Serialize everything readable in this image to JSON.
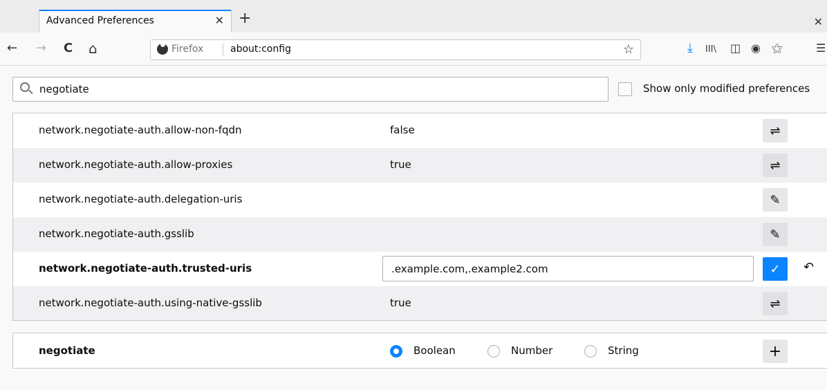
{
  "tab": {
    "title": "Advanced Preferences",
    "close": "✕",
    "new_tab": "+"
  },
  "window": {
    "close": "✕"
  },
  "nav": {
    "back": "←",
    "forward": "→",
    "reload": "C",
    "home": "⌂",
    "identity": "Firefox",
    "url": "about:config",
    "bookmark_star": "☆",
    "download": "⤓",
    "library": "III\\",
    "sidebar": "◫",
    "account": "◉",
    "customize": "⚝",
    "menu": "☰"
  },
  "search": {
    "value": "negotiate",
    "show_modified_label": "Show only modified preferences",
    "show_modified_checked": false
  },
  "prefs": [
    {
      "name": "network.negotiate-auth.allow-non-fqdn",
      "value": "false",
      "action": "⇌",
      "action_type": "toggle",
      "modified": false
    },
    {
      "name": "network.negotiate-auth.allow-proxies",
      "value": "true",
      "action": "⇌",
      "action_type": "toggle",
      "modified": false
    },
    {
      "name": "network.negotiate-auth.delegation-uris",
      "value": "",
      "action": "✎",
      "action_type": "edit",
      "modified": false
    },
    {
      "name": "network.negotiate-auth.gsslib",
      "value": "",
      "action": "✎",
      "action_type": "edit",
      "modified": false
    },
    {
      "name": "network.negotiate-auth.trusted-uris",
      "value": ".example.com,.example2.com",
      "action": "✓",
      "action_type": "save",
      "modified": true,
      "reset": "↶"
    },
    {
      "name": "network.negotiate-auth.using-native-gsslib",
      "value": "true",
      "action": "⇌",
      "action_type": "toggle",
      "modified": false
    }
  ],
  "add_row": {
    "name": "negotiate",
    "types": [
      "Boolean",
      "Number",
      "String"
    ],
    "selected_type": "Boolean",
    "add": "+"
  },
  "colors": {
    "accent": "#0a84ff",
    "row_alt": "#f0f0f2",
    "border": "#c6c6c9"
  }
}
